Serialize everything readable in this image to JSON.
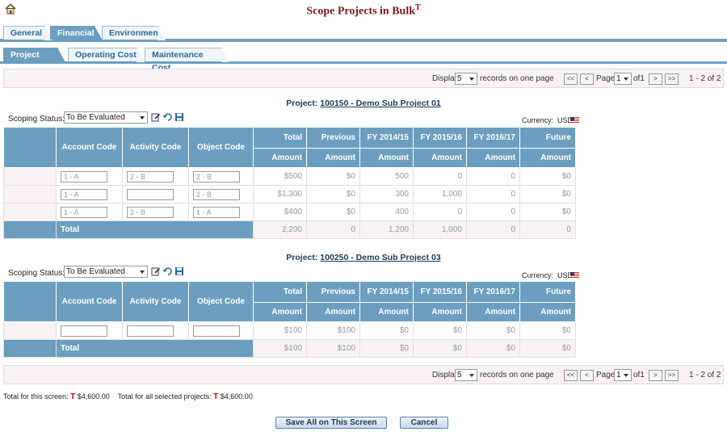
{
  "page": {
    "title": "Scope Projects in Bulk",
    "title_mark": "T"
  },
  "tabs": {
    "main": [
      {
        "label": "General"
      },
      {
        "label": "Financial"
      },
      {
        "label": "Environment"
      }
    ],
    "sub": [
      {
        "label": "Project Cost"
      },
      {
        "label": "Operating Cost"
      },
      {
        "label": "Maintenance Cost"
      }
    ]
  },
  "pager": {
    "display_label": "Display",
    "records_value": "5",
    "records_suffix": "records on one page",
    "page_label": "Page",
    "page_value": "1",
    "of_label": "of1",
    "range_text": "1 - 2 of 2",
    "first": "<<",
    "prev": "<",
    "next": ">",
    "last": ">>"
  },
  "common": {
    "project_prefix": "Project:",
    "status_label": "Scoping Status:",
    "currency_label": "Currency:",
    "currency_code": "USD",
    "headers": {
      "account_code": "Account Code",
      "activity_code": "Activity Code",
      "object_code": "Object Code",
      "total": "Total",
      "previous": "Previous",
      "fy1": "FY 2014/15",
      "fy2": "FY 2015/16",
      "fy3": "FY 2016/17",
      "future": "Future",
      "amount": "Amount"
    },
    "total_label": "Total"
  },
  "projects": [
    {
      "name": "100150 - Demo Sub Project 01",
      "status": "To Be Evaluated",
      "rows": [
        {
          "account": "1 - A",
          "activity": "2 - B",
          "object": "2 - B",
          "total": "$500",
          "previous": "$0",
          "fy1": "500",
          "fy2": "0",
          "fy3": "0",
          "future": "$0"
        },
        {
          "account": "1 - A",
          "activity": "",
          "object": "2 - B",
          "total": "$1,300",
          "previous": "$0",
          "fy1": "300",
          "fy2": "1,000",
          "fy3": "0",
          "future": "$0"
        },
        {
          "account": "1 - A",
          "activity": "2 - B",
          "object": "1 - A",
          "total": "$400",
          "previous": "$0",
          "fy1": "400",
          "fy2": "0",
          "fy3": "0",
          "future": "$0"
        }
      ],
      "totals": {
        "total": "2,200",
        "previous": "0",
        "fy1": "1,200",
        "fy2": "1,000",
        "fy3": "0",
        "future": "0"
      }
    },
    {
      "name": "100250 - Demo Sub Project 03",
      "status": "To Be Evaluated",
      "rows": [
        {
          "account": "",
          "activity": "",
          "object": "",
          "total": "$100",
          "previous": "$100",
          "fy1": "$0",
          "fy2": "$0",
          "fy3": "$0",
          "future": "$0"
        }
      ],
      "totals": {
        "total": "$100",
        "previous": "$100",
        "fy1": "$0",
        "fy2": "$0",
        "fy3": "$0",
        "future": "$0"
      }
    }
  ],
  "footer": {
    "screen_total_label": "Total for this screen:",
    "screen_total_mark": "T",
    "screen_total_value": "$4,600.00",
    "selected_total_label": "Total for all selected projects:",
    "selected_total_mark": "T",
    "selected_total_value": "$4,600.00",
    "save_button": "Save All on This Screen",
    "cancel_button": "Cancel"
  },
  "colors": {
    "header_blue": "#6c9fbf",
    "title_red": "#7a1b1b",
    "mark_red": "#cc0000"
  },
  "icons": [
    "home-icon",
    "edit-icon",
    "undo-icon",
    "save-icon",
    "us-flag-icon"
  ]
}
